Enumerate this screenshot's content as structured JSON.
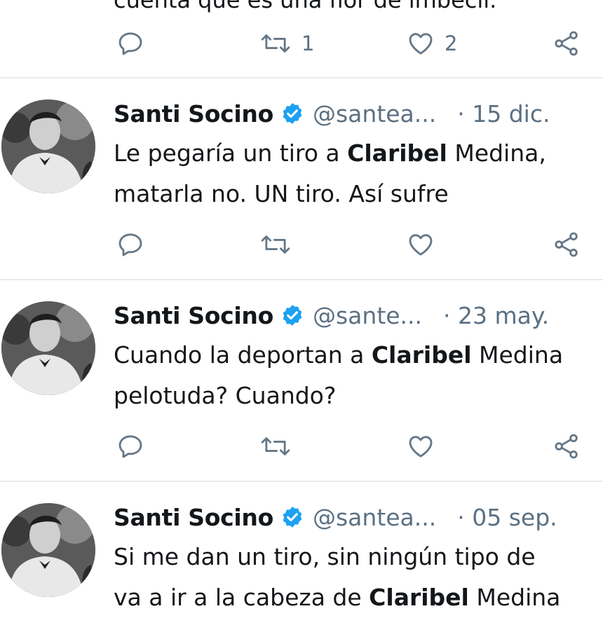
{
  "top_clip": {
    "text": "cuenta que es una flor de imbécil."
  },
  "top_actions": {
    "reply": "",
    "retweet": "1",
    "like": "2"
  },
  "tweets": [
    {
      "name": "Santi Socino",
      "handle": "@santea...",
      "date": "· 15 dic.",
      "line1": [
        "Le pegaría un tiro a ",
        "Claribel",
        " Medina,"
      ],
      "line2": [
        "matarla no. UN tiro. Así sufre",
        "",
        ""
      ],
      "reply": "",
      "retweet": "",
      "like": ""
    },
    {
      "name": "Santi Socino",
      "handle": "@sante...",
      "date": "· 23 may.",
      "line1": [
        "Cuando la deportan a ",
        "Claribel",
        " Medina"
      ],
      "line2": [
        "pelotuda? Cuando?",
        "",
        ""
      ],
      "reply": "",
      "retweet": "",
      "like": ""
    },
    {
      "name": "Santi Socino",
      "handle": "@santea...",
      "date": "· 05 sep.",
      "line1": [
        "Si me dan un tiro, sin ningún tipo de ",
        "",
        ""
      ],
      "line2": [
        "va a ir a la cabeza de ",
        "Claribel",
        " Medina"
      ]
    }
  ],
  "colors": {
    "verified": "#1da1f2",
    "icon": "#657786",
    "divider": "#e6ecf0"
  },
  "icons": [
    "reply-icon",
    "retweet-icon",
    "like-icon",
    "share-icon",
    "verified-icon"
  ]
}
